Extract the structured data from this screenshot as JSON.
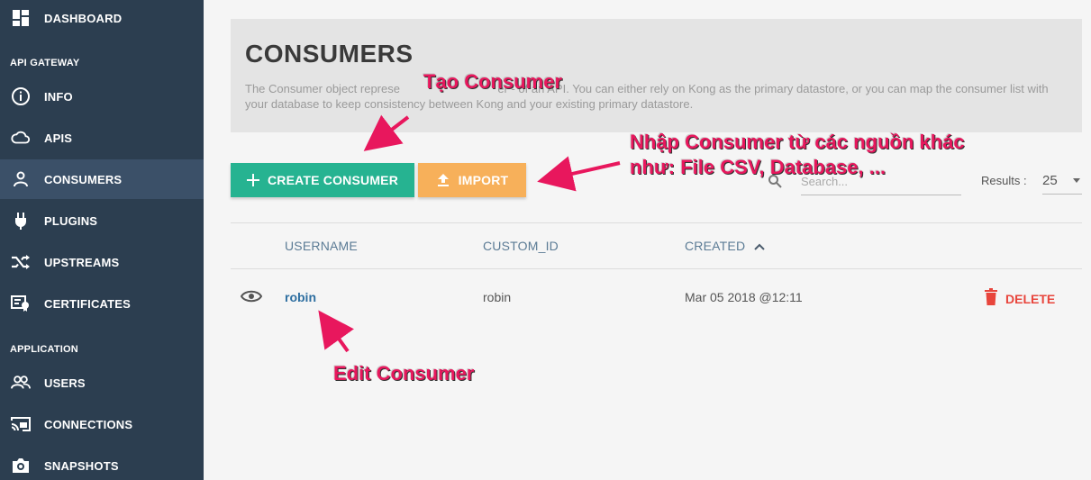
{
  "sidebar": {
    "dashboard": "DASHBOARD",
    "section_api": "API GATEWAY",
    "items_api": [
      {
        "label": "INFO",
        "icon": "info-icon"
      },
      {
        "label": "APIS",
        "icon": "cloud-icon"
      },
      {
        "label": "CONSUMERS",
        "icon": "user-icon"
      },
      {
        "label": "PLUGINS",
        "icon": "plug-icon"
      },
      {
        "label": "UPSTREAMS",
        "icon": "shuffle-icon"
      },
      {
        "label": "CERTIFICATES",
        "icon": "certificate-icon"
      }
    ],
    "section_app": "APPLICATION",
    "items_app": [
      {
        "label": "USERS",
        "icon": "users-icon"
      },
      {
        "label": "CONNECTIONS",
        "icon": "cast-icon"
      },
      {
        "label": "SNAPSHOTS",
        "icon": "camera-icon"
      }
    ],
    "active": "CONSUMERS"
  },
  "page": {
    "title": "CONSUMERS",
    "description": "The Consumer object represe                              er - of an API. You can either rely on Kong as the primary datastore, or you can map the consumer list with your database to keep consistency between Kong and your existing primary datastore."
  },
  "toolbar": {
    "create_label": "CREATE CONSUMER",
    "import_label": "IMPORT",
    "search_placeholder": "Search...",
    "results_label": "Results :",
    "results_value": "25"
  },
  "table": {
    "columns": [
      "USERNAME",
      "CUSTOM_ID",
      "CREATED"
    ],
    "sort_column": "CREATED",
    "sort_direction": "asc",
    "rows": [
      {
        "username": "robin",
        "custom_id": "robin",
        "created": "Mar 05 2018 @12:11",
        "action": "DELETE"
      }
    ]
  },
  "annotations": {
    "create": "Tạo Consumer",
    "import_line1": "Nhập Consumer từ các nguồn khác",
    "import_line2": "như: File CSV, Database, ...",
    "edit": "Edit Consumer"
  },
  "colors": {
    "sidebar_bg": "#2c3e50",
    "create_btn": "#26b391",
    "import_btn": "#f7b05a",
    "delete": "#e8453c",
    "annotation": "#e8175d",
    "link": "#2d6ea0"
  }
}
